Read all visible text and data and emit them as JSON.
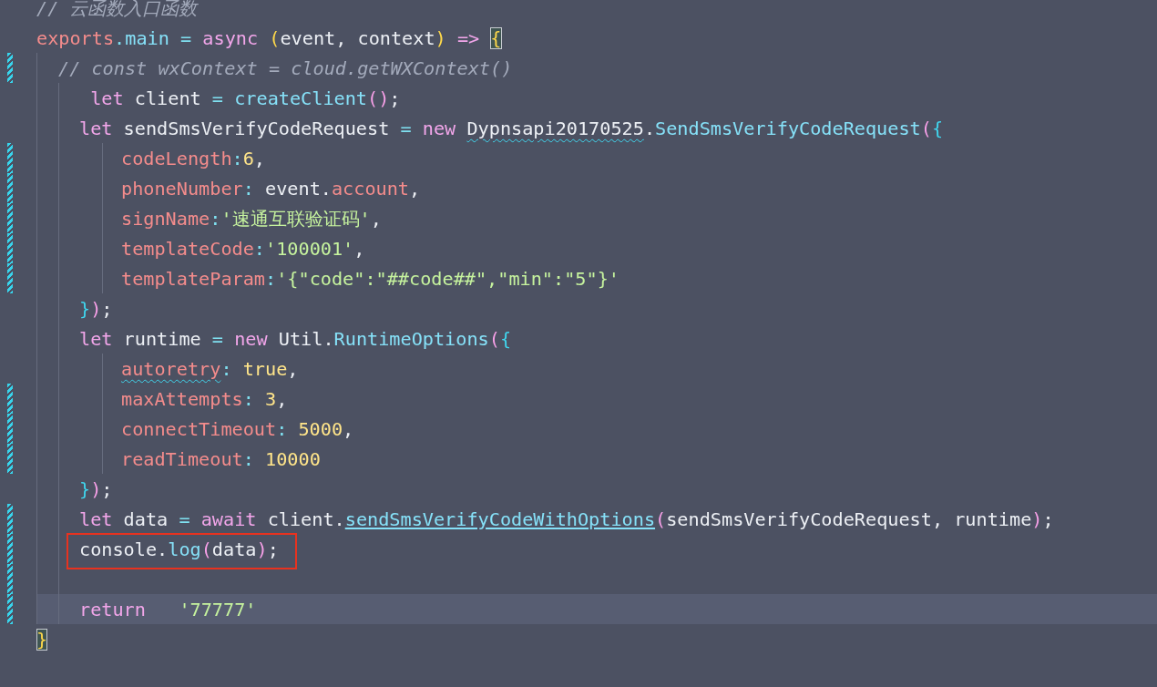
{
  "editor": {
    "lines": [
      {
        "changed": false,
        "current": false,
        "boxed": false,
        "tokens": [
          {
            "kind": "comment",
            "text": "// 云函数入口函数"
          }
        ]
      },
      {
        "changed": false,
        "current": false,
        "boxed": false,
        "tokens": [
          {
            "kind": "name",
            "text": "exports"
          },
          {
            "kind": "op",
            "text": "."
          },
          {
            "kind": "func",
            "text": "main"
          },
          {
            "kind": "op",
            "text": " = "
          },
          {
            "kind": "keyword",
            "text": "async "
          },
          {
            "kind": "paren",
            "text": "("
          },
          {
            "kind": "plain",
            "text": "event, context"
          },
          {
            "kind": "paren",
            "text": ")"
          },
          {
            "kind": "keyword",
            "text": " => "
          },
          {
            "kind": "bracket-match",
            "text": "{"
          }
        ],
        "children": [
          {
            "changed": true,
            "current": false,
            "boxed": false,
            "tokens": [
              {
                "kind": "comment",
                "text": "// const wxContext = cloud.getWXContext()"
              }
            ],
            "children": [
              {
                "changed": false,
                "current": false,
                "boxed": false,
                "tokens": [
                  {
                    "kind": "keyword",
                    "text": " let"
                  },
                  {
                    "kind": "plain",
                    "text": " client "
                  },
                  {
                    "kind": "op",
                    "text": "= "
                  },
                  {
                    "kind": "func",
                    "text": "createClient"
                  },
                  {
                    "kind": "paren-pink",
                    "text": "()"
                  },
                  {
                    "kind": "plain",
                    "text": ";"
                  }
                ]
              },
              {
                "changed": false,
                "current": false,
                "boxed": false,
                "tokens": [
                  {
                    "kind": "keyword",
                    "text": "let"
                  },
                  {
                    "kind": "plain",
                    "text": " sendSmsVerifyCodeRequest "
                  },
                  {
                    "kind": "op",
                    "text": "= "
                  },
                  {
                    "kind": "keyword",
                    "text": "new "
                  },
                  {
                    "kind": "warn-class",
                    "text": "Dypnsapi20170525"
                  },
                  {
                    "kind": "plain",
                    "text": "."
                  },
                  {
                    "kind": "func",
                    "text": "SendSmsVerifyCodeRequest"
                  },
                  {
                    "kind": "paren-pink",
                    "text": "("
                  },
                  {
                    "kind": "brace",
                    "text": "{"
                  }
                ],
                "children": [
                  {
                    "changed": true,
                    "current": false,
                    "boxed": false,
                    "tokens": [
                      {
                        "kind": "name",
                        "text": "codeLength"
                      },
                      {
                        "kind": "op",
                        "text": ":"
                      },
                      {
                        "kind": "number",
                        "text": "6"
                      },
                      {
                        "kind": "plain",
                        "text": ","
                      }
                    ]
                  },
                  {
                    "changed": true,
                    "current": false,
                    "boxed": false,
                    "tokens": [
                      {
                        "kind": "name",
                        "text": "phoneNumber"
                      },
                      {
                        "kind": "op",
                        "text": ":"
                      },
                      {
                        "kind": "plain",
                        "text": " event."
                      },
                      {
                        "kind": "name",
                        "text": "account"
                      },
                      {
                        "kind": "plain",
                        "text": ","
                      }
                    ]
                  },
                  {
                    "changed": true,
                    "current": false,
                    "boxed": false,
                    "tokens": [
                      {
                        "kind": "name",
                        "text": "signName"
                      },
                      {
                        "kind": "op",
                        "text": ":"
                      },
                      {
                        "kind": "string",
                        "text": "'速通互联验证码'"
                      },
                      {
                        "kind": "plain",
                        "text": ","
                      }
                    ]
                  },
                  {
                    "changed": true,
                    "current": false,
                    "boxed": false,
                    "tokens": [
                      {
                        "kind": "name",
                        "text": "templateCode"
                      },
                      {
                        "kind": "op",
                        "text": ":"
                      },
                      {
                        "kind": "string",
                        "text": "'100001'"
                      },
                      {
                        "kind": "plain",
                        "text": ","
                      }
                    ]
                  },
                  {
                    "changed": true,
                    "current": false,
                    "boxed": false,
                    "tokens": [
                      {
                        "kind": "name",
                        "text": "templateParam"
                      },
                      {
                        "kind": "op",
                        "text": ":"
                      },
                      {
                        "kind": "string",
                        "text": "'{\"code\":\"##code##\",\"min\":\"5\"}'"
                      }
                    ]
                  }
                ]
              },
              {
                "changed": false,
                "current": false,
                "boxed": false,
                "tokens": [
                  {
                    "kind": "brace",
                    "text": "}"
                  },
                  {
                    "kind": "paren-pink",
                    "text": ")"
                  },
                  {
                    "kind": "plain",
                    "text": ";"
                  }
                ]
              },
              {
                "changed": false,
                "current": false,
                "boxed": false,
                "tokens": [
                  {
                    "kind": "keyword",
                    "text": "let"
                  },
                  {
                    "kind": "plain",
                    "text": " runtime "
                  },
                  {
                    "kind": "op",
                    "text": "= "
                  },
                  {
                    "kind": "keyword",
                    "text": "new"
                  },
                  {
                    "kind": "plain",
                    "text": " Util."
                  },
                  {
                    "kind": "func",
                    "text": "RuntimeOptions"
                  },
                  {
                    "kind": "paren-pink",
                    "text": "("
                  },
                  {
                    "kind": "brace",
                    "text": "{"
                  }
                ],
                "children": [
                  {
                    "changed": false,
                    "current": false,
                    "boxed": false,
                    "tokens": [
                      {
                        "kind": "warn-name",
                        "text": "autoretry"
                      },
                      {
                        "kind": "op",
                        "text": ": "
                      },
                      {
                        "kind": "number",
                        "text": "true"
                      },
                      {
                        "kind": "plain",
                        "text": ","
                      }
                    ]
                  },
                  {
                    "changed": true,
                    "current": false,
                    "boxed": false,
                    "tokens": [
                      {
                        "kind": "name",
                        "text": "maxAttempts"
                      },
                      {
                        "kind": "op",
                        "text": ": "
                      },
                      {
                        "kind": "number",
                        "text": "3"
                      },
                      {
                        "kind": "plain",
                        "text": ","
                      }
                    ]
                  },
                  {
                    "changed": true,
                    "current": false,
                    "boxed": false,
                    "tokens": [
                      {
                        "kind": "name",
                        "text": "connectTimeout"
                      },
                      {
                        "kind": "op",
                        "text": ": "
                      },
                      {
                        "kind": "number",
                        "text": "5000"
                      },
                      {
                        "kind": "plain",
                        "text": ","
                      }
                    ]
                  },
                  {
                    "changed": true,
                    "current": false,
                    "boxed": false,
                    "tokens": [
                      {
                        "kind": "name",
                        "text": "readTimeout"
                      },
                      {
                        "kind": "op",
                        "text": ": "
                      },
                      {
                        "kind": "number",
                        "text": "10000"
                      }
                    ]
                  }
                ]
              },
              {
                "changed": false,
                "current": false,
                "boxed": false,
                "tokens": [
                  {
                    "kind": "brace",
                    "text": "}"
                  },
                  {
                    "kind": "paren-pink",
                    "text": ")"
                  },
                  {
                    "kind": "plain",
                    "text": ";"
                  }
                ]
              },
              {
                "changed": true,
                "current": false,
                "boxed": false,
                "tokens": [
                  {
                    "kind": "keyword",
                    "text": "let"
                  },
                  {
                    "kind": "plain",
                    "text": " data "
                  },
                  {
                    "kind": "op",
                    "text": "= "
                  },
                  {
                    "kind": "keyword",
                    "text": "await"
                  },
                  {
                    "kind": "plain",
                    "text": " client."
                  },
                  {
                    "kind": "link-func",
                    "text": "sendSmsVerifyCodeWithOptions"
                  },
                  {
                    "kind": "paren-pink",
                    "text": "("
                  },
                  {
                    "kind": "plain",
                    "text": "sendSmsVerifyCodeRequest, runtime"
                  },
                  {
                    "kind": "paren-pink",
                    "text": ")"
                  },
                  {
                    "kind": "plain",
                    "text": ";"
                  }
                ]
              },
              {
                "changed": true,
                "current": false,
                "boxed": true,
                "tokens": [
                  {
                    "kind": "plain",
                    "text": "console."
                  },
                  {
                    "kind": "func",
                    "text": "log"
                  },
                  {
                    "kind": "paren-pink",
                    "text": "("
                  },
                  {
                    "kind": "plain",
                    "text": "data"
                  },
                  {
                    "kind": "paren-pink",
                    "text": ")"
                  },
                  {
                    "kind": "plain",
                    "text": ";"
                  }
                ]
              },
              {
                "changed": true,
                "current": false,
                "boxed": false
              },
              {
                "changed": true,
                "current": true,
                "boxed": false,
                "tokens": [
                  {
                    "kind": "keyword",
                    "text": "return   "
                  },
                  {
                    "kind": "string",
                    "text": "'77777'"
                  }
                ]
              }
            ]
          }
        ]
      },
      {
        "changed": false,
        "current": false,
        "boxed": false,
        "tokens": [
          {
            "kind": "bracket-match",
            "text": "}"
          }
        ]
      }
    ]
  }
}
